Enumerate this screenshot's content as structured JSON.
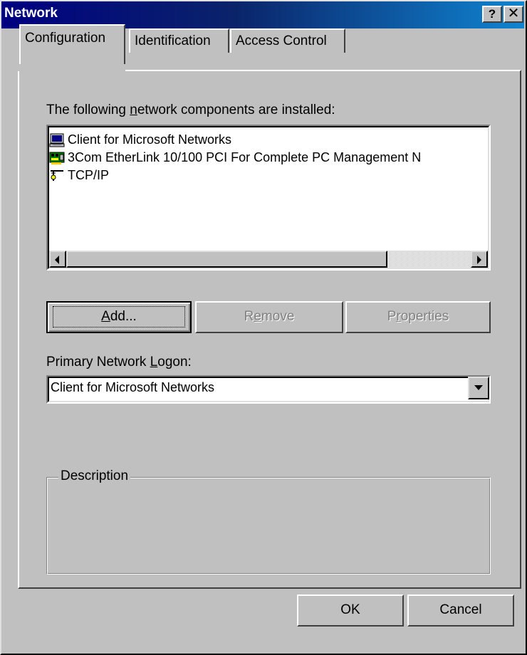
{
  "window": {
    "title": "Network",
    "help_glyph": "?",
    "close_glyph": "✕"
  },
  "tabs": [
    {
      "label": "Configuration",
      "active": true
    },
    {
      "label": "Identification",
      "active": false
    },
    {
      "label": "Access Control",
      "active": false
    }
  ],
  "components": {
    "label_prefix": "The following ",
    "label_accel": "n",
    "label_suffix": "etwork components are installed:",
    "items": [
      {
        "label": "Client for Microsoft Networks",
        "icon": "network-client-icon"
      },
      {
        "label": "3Com EtherLink 10/100 PCI For Complete PC Management N",
        "icon": "network-adapter-icon"
      },
      {
        "label": "TCP/IP",
        "icon": "network-protocol-icon"
      }
    ]
  },
  "buttons": {
    "add_accel": "A",
    "add_rest": "dd...",
    "remove_pre": "R",
    "remove_accel": "e",
    "remove_rest": "move",
    "props_pre": "P",
    "props_accel": "r",
    "props_rest": "operties",
    "ok": "OK",
    "cancel": "Cancel"
  },
  "logon": {
    "label_prefix": "Primary Network ",
    "label_accel": "L",
    "label_suffix": "ogon:",
    "value": "Client for Microsoft Networks"
  },
  "description": {
    "legend": "Description"
  },
  "colors": {
    "face": "#c0c0c0",
    "title_active": "#000080",
    "disabled_text": "#808080"
  }
}
